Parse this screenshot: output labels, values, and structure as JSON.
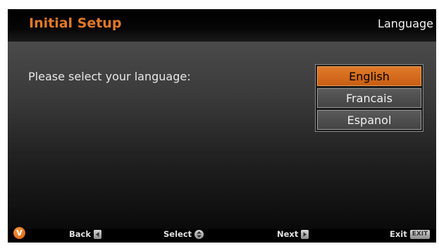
{
  "header": {
    "title": "Initial Setup",
    "section": "Language"
  },
  "main": {
    "prompt": "Please select your language:",
    "languages": [
      {
        "label": "English",
        "selected": true
      },
      {
        "label": "Francais",
        "selected": false
      },
      {
        "label": "Espanol",
        "selected": false
      }
    ]
  },
  "footer": {
    "logo_icon": "vizio-v-logo-icon",
    "back_label": "Back",
    "select_label": "Select",
    "next_label": "Next",
    "exit_label": "Exit",
    "exit_key_label": "EXIT"
  },
  "colors": {
    "accent": "#e2782a",
    "selected_bg": "#d66b1e"
  }
}
